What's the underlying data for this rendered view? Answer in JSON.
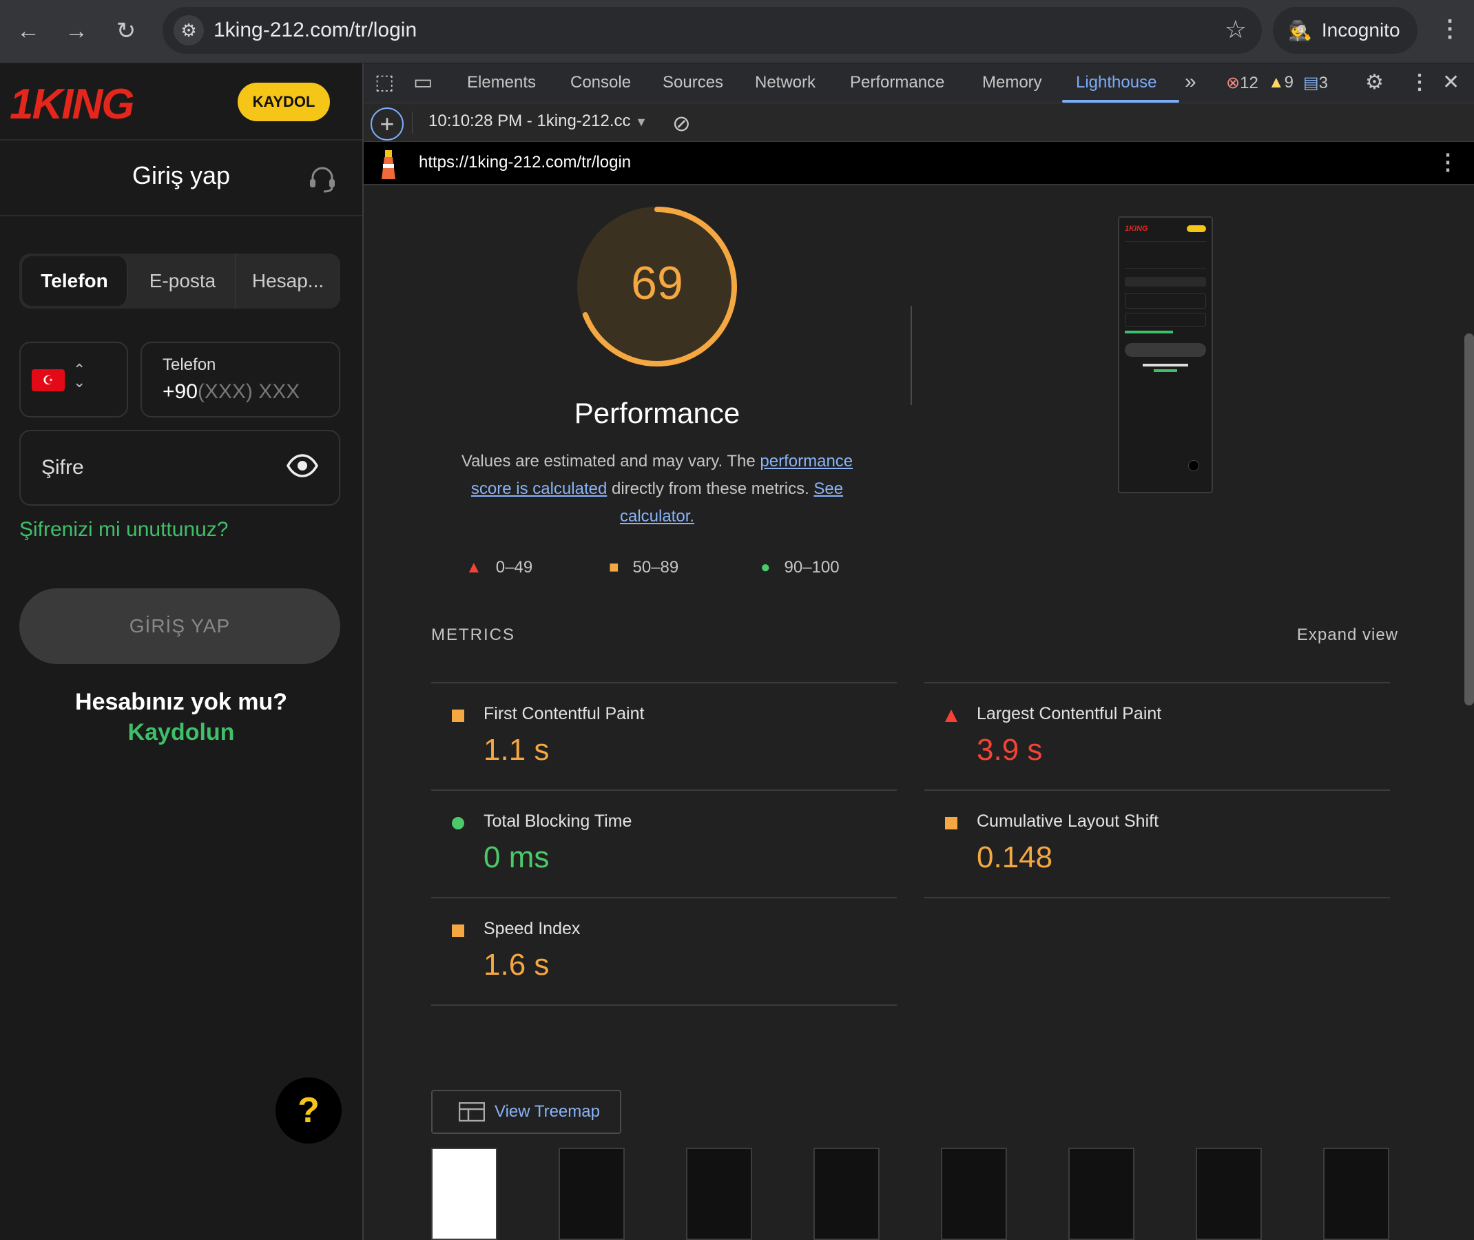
{
  "browser": {
    "url": "1king-212.com/tr/login",
    "incognito_label": "Incognito",
    "back": "←",
    "forward": "→",
    "reload": "↻",
    "star": "☆",
    "menu": "⋮"
  },
  "page": {
    "logo": "1KING",
    "signup_button": "KAYDOL",
    "title": "Giriş yap",
    "tabs": [
      "Telefon",
      "E-posta",
      "Hesap..."
    ],
    "flag": "☪",
    "phone_label": "Telefon",
    "phone_prefix": "+90",
    "phone_placeholder": "(XXX) XXX",
    "password_placeholder": "Şifre",
    "forgot": "Şifrenizi mi unuttunuz?",
    "login_button": "GİRİŞ YAP",
    "no_account": "Hesabınız yok mu?",
    "register_link": "Kaydolun",
    "help": "?"
  },
  "devtools": {
    "tabs": [
      "Elements",
      "Console",
      "Sources",
      "Network",
      "Performance",
      "Memory",
      "Lighthouse"
    ],
    "active_tab": "Lighthouse",
    "errors": "12",
    "warnings": "9",
    "messages": "3",
    "report_time": "10:10:28 PM - 1king-212.cc",
    "report_url": "https://1king-212.com/tr/login"
  },
  "lighthouse": {
    "score": "69",
    "score_fraction": 0.69,
    "category": "Performance",
    "desc_1": "Values are estimated and may vary. The ",
    "desc_link_1": "performance score is calculated",
    "desc_2": " directly from these metrics. ",
    "desc_link_2": "See calculator.",
    "legend": [
      "0–49",
      "50–89",
      "90–100"
    ],
    "metrics_heading": "METRICS",
    "expand_view": "Expand view",
    "metrics": [
      {
        "name": "First Contentful Paint",
        "value": "1.1 s",
        "status": "average"
      },
      {
        "name": "Largest Contentful Paint",
        "value": "3.9 s",
        "status": "fail"
      },
      {
        "name": "Total Blocking Time",
        "value": "0 ms",
        "status": "pass"
      },
      {
        "name": "Cumulative Layout Shift",
        "value": "0.148",
        "status": "average"
      },
      {
        "name": "Speed Index",
        "value": "1.6 s",
        "status": "average"
      }
    ],
    "treemap_button": "View Treemap",
    "colors": {
      "fail": "#f44336",
      "average": "#f5a842",
      "pass": "#4cca6a",
      "link": "#8ab4f8"
    }
  }
}
